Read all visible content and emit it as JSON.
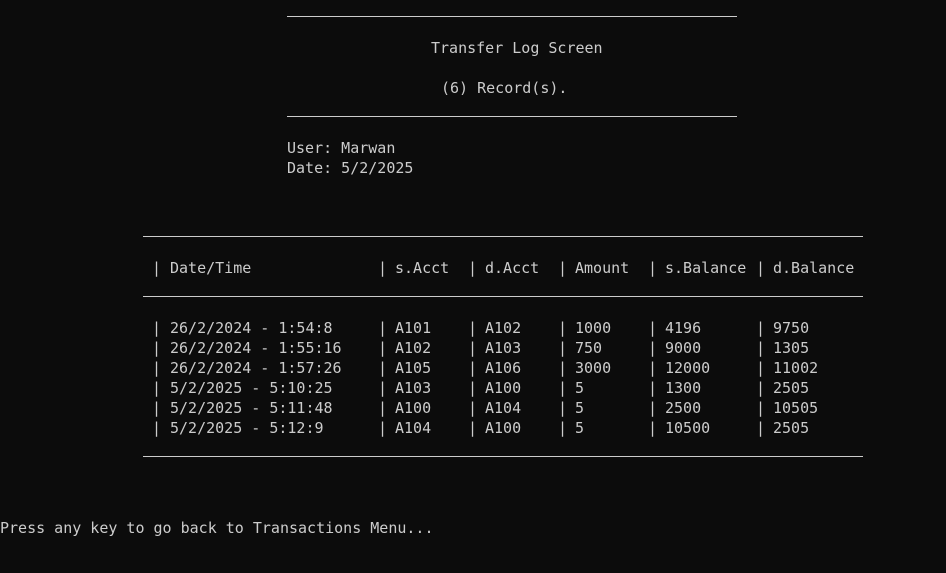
{
  "header": {
    "title": "Transfer Log Screen",
    "record_count": "(6) Record(s)."
  },
  "info": {
    "user": "User: Marwan",
    "date": "Date: 5/2/2025"
  },
  "table": {
    "columns": [
      "Date/Time",
      "s.Acct",
      "d.Acct",
      "Amount",
      "s.Balance",
      "d.Balance"
    ],
    "rows": [
      [
        "26/2/2024 - 1:54:8",
        "A101",
        "A102",
        "1000",
        "4196",
        "9750"
      ],
      [
        "26/2/2024 - 1:55:16",
        "A102",
        "A103",
        "750",
        "9000",
        "1305"
      ],
      [
        "26/2/2024 - 1:57:26",
        "A105",
        "A106",
        "3000",
        "12000",
        "11002"
      ],
      [
        "5/2/2025 - 5:10:25",
        "A103",
        "A100",
        "5",
        "1300",
        "2505"
      ],
      [
        "5/2/2025 - 5:11:48",
        "A100",
        "A104",
        "5",
        "2500",
        "10505"
      ],
      [
        "5/2/2025 - 5:12:9",
        "A104",
        "A100",
        "5",
        "10500",
        "2505"
      ]
    ]
  },
  "footer": {
    "prompt": "Press any key to go back to Transactions Menu..."
  }
}
